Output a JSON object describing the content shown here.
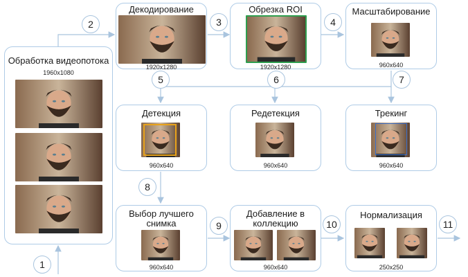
{
  "nodes": {
    "video": {
      "title": "Обработка видеопотока",
      "res": "1960x1080"
    },
    "decode": {
      "title": "Декодирование",
      "res": "1920x1280"
    },
    "roi": {
      "title": "Обрезка ROI",
      "res": "1920x1280"
    },
    "scale": {
      "title": "Масштабирование",
      "res": "960x640"
    },
    "detect": {
      "title": "Детекция",
      "res": "960x640"
    },
    "redetect": {
      "title": "Редетекция",
      "res": "960x640"
    },
    "track": {
      "title": "Трекинг",
      "res": "960x640"
    },
    "best": {
      "title_line1": "Выбор лучшего",
      "title_line2": "снимка",
      "res": "960x640"
    },
    "collect": {
      "title_line1": "Добавление в",
      "title_line2": "коллекцию",
      "res": "960x640"
    },
    "norm": {
      "title": "Нормализация",
      "res": "250x250"
    }
  },
  "steps": [
    "1",
    "2",
    "3",
    "4",
    "5",
    "6",
    "7",
    "8",
    "9",
    "10",
    "11"
  ],
  "colors": {
    "box_border": "#aecbe6",
    "arrow": "#a9c4de",
    "roi_frame": "#2e9e4f",
    "detect_frame": "#e8a21a",
    "track_frame": "#3b6fc9"
  }
}
